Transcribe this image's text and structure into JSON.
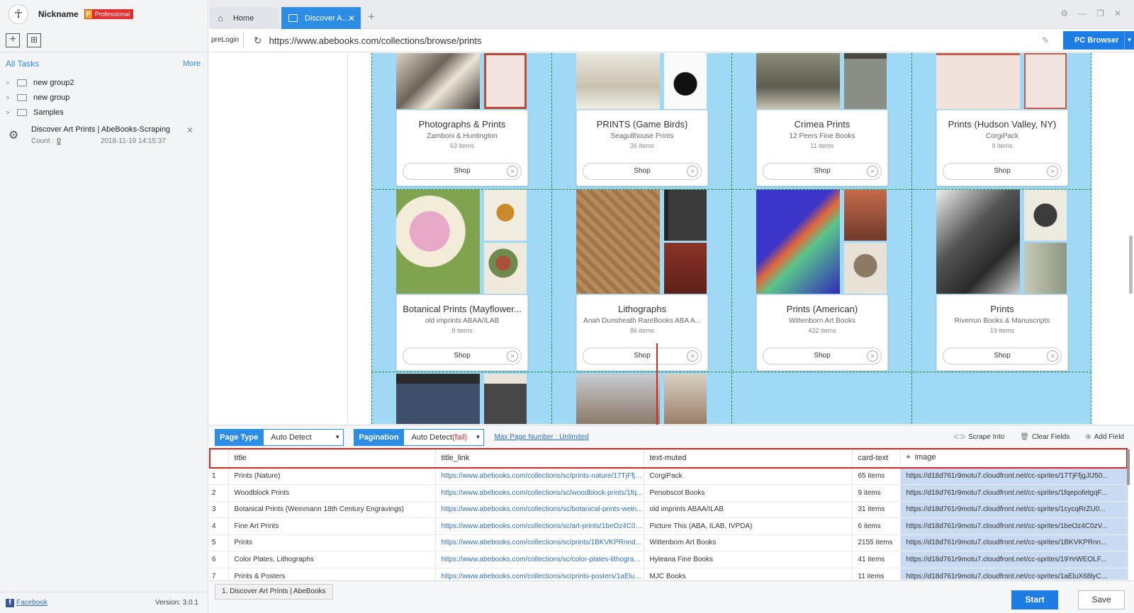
{
  "sidebar": {
    "nickname": "Nickname",
    "badge_letter": "P",
    "badge_text": "Professional",
    "all_tasks": "All Tasks",
    "more": "More",
    "groups": [
      "new group2",
      "new group",
      "Samples"
    ],
    "task": {
      "name": "Discover Art Prints | AbeBooks-Scraping",
      "count_label": "Count :",
      "count_value": "0",
      "date": "2018-11-19 14:15:37"
    },
    "facebook": "Facebook",
    "version": "Version: 3.0.1"
  },
  "tabs": {
    "home": "Home",
    "active": "Discover A..."
  },
  "address": {
    "prelogin": "preLogin",
    "url": "https://www.abebooks.com/collections/browse/prints",
    "pc_browser": "PC Browser"
  },
  "cards": [
    {
      "title": "Photographs & Prints",
      "seller": "Zamboni & Huntington",
      "count": "63 items",
      "shop": "Shop"
    },
    {
      "title": "PRINTS (Game Birds)",
      "seller": "Seagullhouse Prints",
      "count": "36 items",
      "shop": "Shop"
    },
    {
      "title": "Crimea Prints",
      "seller": "12 Peers Fine Books",
      "count": "11 items",
      "shop": "Shop"
    },
    {
      "title": "Prints (Hudson Valley, NY)",
      "seller": "CorgiPack",
      "count": "9 items",
      "shop": "Shop"
    },
    {
      "title": "Botanical Prints (Mayflower...",
      "seller": "old imprints ABAA/ILAB",
      "count": "8 items",
      "shop": "Shop"
    },
    {
      "title": "Lithographs",
      "seller": "Anah Dunsheath RareBooks ABA A...",
      "count": "86 items",
      "shop": "Shop"
    },
    {
      "title": "Prints (American)",
      "seller": "Wittenborn Art Books",
      "count": "432 items",
      "shop": "Shop"
    },
    {
      "title": "Prints",
      "seller": "Riverrun Books & Manuscripts",
      "count": "19 items",
      "shop": "Shop"
    }
  ],
  "controls": {
    "page_type_label": "Page Type",
    "page_type_value": "Auto Detect",
    "pagination_label": "Pagination",
    "pagination_value": "Auto Detect",
    "pagination_fail": "(fail)",
    "max_page": "Max Page Number : Unlimited",
    "scrape_into": "Scrape Into",
    "clear_fields": "Clear Fields",
    "add_field": "Add Field"
  },
  "table": {
    "headers": [
      "title",
      "title_link",
      "text-muted",
      "card-text",
      "image"
    ],
    "rows": [
      [
        "1",
        "Prints (Nature)",
        "https://www.abebooks.com/collections/sc/prints-nature/17TjFfjg...",
        "CorgiPack",
        "65 items",
        "https://d18d761r9motu7.cloudfront.net/cc-sprites/17TjFfjgJlJ50..."
      ],
      [
        "2",
        "Woodblock Prints",
        "https://www.abebooks.com/collections/sc/woodblock-prints/1fq...",
        "Penobscot Books",
        "9 items",
        "https://d18d761r9motu7.cloudfront.net/cc-sprites/1fqepofetgqF..."
      ],
      [
        "3",
        "Botanical Prints (Weinmann 18th Century Engravings)",
        "https://www.abebooks.com/collections/sc/botanical-prints-wein...",
        "old imprints ABAA/ILAB",
        "31 items",
        "https://d18d761r9motu7.cloudfront.net/cc-sprites/1cycqRrZU0..."
      ],
      [
        "4",
        "Fine Art Prints",
        "https://www.abebooks.com/collections/sc/art-prints/1beOz4C0z...",
        "Picture This (ABA, ILAB, IVPDA)",
        "6 items",
        "https://d18d761r9motu7.cloudfront.net/cc-sprites/1beOz4C0zV..."
      ],
      [
        "5",
        "Prints",
        "https://www.abebooks.com/collections/sc/prints/1BKVKPRnnd...",
        "Wittenborn Art Books",
        "2155 items",
        "https://d18d761r9motu7.cloudfront.net/cc-sprites/1BKVKPRnn..."
      ],
      [
        "6",
        "Color Plates, Lithographs",
        "https://www.abebooks.com/collections/sc/color-plates-lithograp...",
        "Hyleana Fine Books",
        "41 items",
        "https://d18d761r9motu7.cloudfront.net/cc-sprites/19YeWEOLF..."
      ],
      [
        "7",
        "Prints & Posters",
        "https://www.abebooks.com/collections/sc/prints-posters/1aEluX...",
        "MJC Books",
        "11 items",
        "https://d18d761r9motu7.cloudfront.net/cc-sprites/1aEluX68lyC..."
      ]
    ]
  },
  "footer": {
    "task_tab": "1. Discover Art Prints | AbeBooks",
    "start": "Start",
    "save": "Save"
  },
  "colors": {
    "accent": "#2d8ce3",
    "grid_bg": "#9fd9f6",
    "highlight": "#d62626"
  }
}
